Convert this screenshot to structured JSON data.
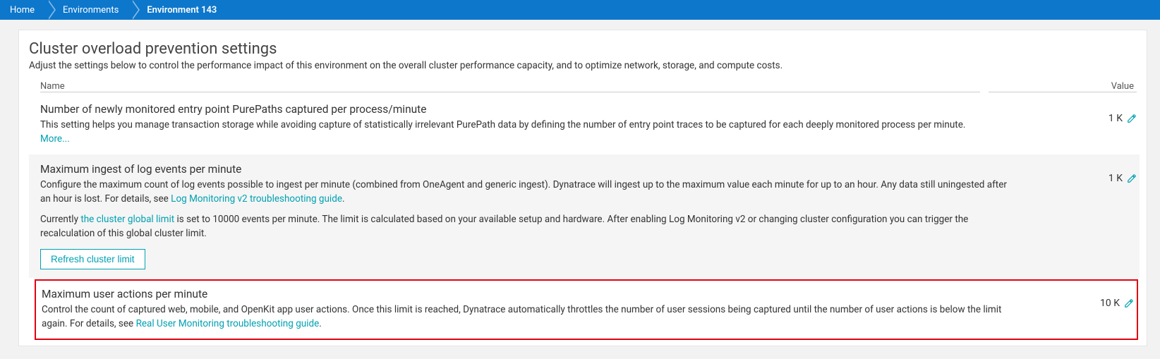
{
  "breadcrumb": {
    "items": [
      {
        "label": "Home"
      },
      {
        "label": "Environments"
      },
      {
        "label": "Environment 143"
      }
    ]
  },
  "page": {
    "title": "Cluster overload prevention settings",
    "subtitle": "Adjust the settings below to control the performance impact of this environment on the overall cluster performance capacity, and to optimize network, storage, and compute costs."
  },
  "columns": {
    "name": "Name",
    "value": "Value"
  },
  "settings": [
    {
      "title": "Number of newly monitored entry point PurePaths captured per process/minute",
      "desc_pre": "This setting helps you manage transaction storage while avoiding capture of statistically irrelevant PurePath data by defining the number of entry point traces to be captured for each deeply monitored process per minute. ",
      "more_link": "More...",
      "value": "1 K"
    },
    {
      "title": "Maximum ingest of log events per minute",
      "desc_pre": "Configure the maximum count of log events possible to ingest per minute (combined from OneAgent and generic ingest). Dynatrace will ingest up to the maximum value each minute for up to an hour. Any data still uningested after an hour is lost. For details, see ",
      "guide_link": "Log Monitoring v2 troubleshooting guide",
      "desc_post": ".",
      "para2_pre": "Currently ",
      "cluster_link": "the cluster global limit",
      "para2_post": " is set to 10000 events per minute. The limit is calculated based on your available setup and hardware. After enabling Log Monitoring v2 or changing cluster configuration you can trigger the recalculation of this global cluster limit.",
      "button": "Refresh cluster limit",
      "value": "1 K"
    },
    {
      "title": "Maximum user actions per minute",
      "desc_pre": "Control the count of captured web, mobile, and OpenKit app user actions. Once this limit is reached, Dynatrace automatically throttles the number of user sessions being captured until the number of user actions is below the limit again. For details, see ",
      "guide_link": "Real User Monitoring troubleshooting guide",
      "desc_post": ".",
      "value": "10 K"
    }
  ]
}
